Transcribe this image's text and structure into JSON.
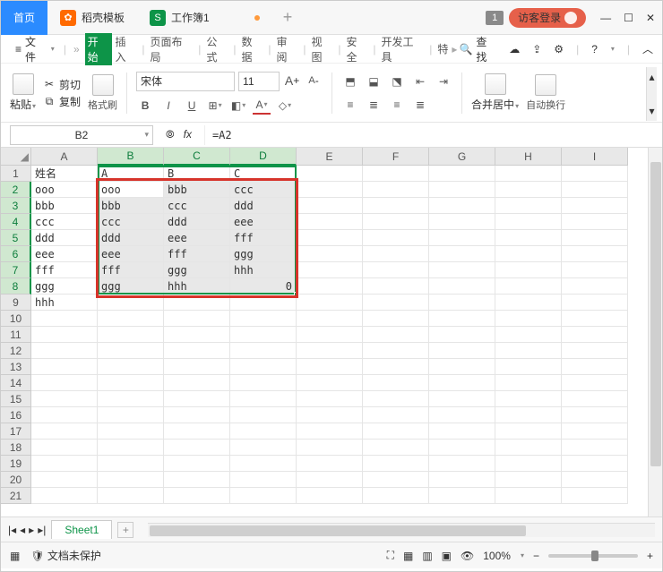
{
  "titlebar": {
    "home": "首页",
    "shell": "稻壳模板",
    "doc": "工作簿1",
    "badge": "1",
    "login": "访客登录"
  },
  "menu": {
    "file": "文件",
    "items": [
      "开始",
      "插入",
      "页面布局",
      "公式",
      "数据",
      "审阅",
      "视图",
      "安全",
      "开发工具",
      "特"
    ],
    "search": "查找"
  },
  "ribbon": {
    "paste": "粘贴",
    "cut": "剪切",
    "copy": "复制",
    "painter": "格式刷",
    "font": "宋体",
    "size": "11",
    "merge": "合并居中",
    "wrap": "自动换行"
  },
  "fx": {
    "nameref": "B2",
    "formula": "=A2"
  },
  "columns": [
    "A",
    "B",
    "C",
    "D",
    "E",
    "F",
    "G",
    "H",
    "I"
  ],
  "rows": [
    "1",
    "2",
    "3",
    "4",
    "5",
    "6",
    "7",
    "8",
    "9",
    "10",
    "11",
    "12",
    "13",
    "14",
    "15",
    "16",
    "17",
    "18",
    "19",
    "20",
    "21"
  ],
  "data": {
    "r1": {
      "A": "姓名",
      "B": "A",
      "C": "B",
      "D": "C"
    },
    "r2": {
      "A": "ooo",
      "B": "ooo",
      "C": "bbb",
      "D": "ccc"
    },
    "r3": {
      "A": "bbb",
      "B": "bbb",
      "C": "ccc",
      "D": "ddd"
    },
    "r4": {
      "A": "ccc",
      "B": "ccc",
      "C": "ddd",
      "D": "eee"
    },
    "r5": {
      "A": "ddd",
      "B": "ddd",
      "C": "eee",
      "D": "fff"
    },
    "r6": {
      "A": "eee",
      "B": "eee",
      "C": "fff",
      "D": "ggg"
    },
    "r7": {
      "A": "fff",
      "B": "fff",
      "C": "ggg",
      "D": "hhh"
    },
    "r8": {
      "A": "ggg",
      "B": "ggg",
      "C": "hhh",
      "D": "0"
    },
    "r9": {
      "A": "hhh"
    }
  },
  "sheet": {
    "name": "Sheet1"
  },
  "status": {
    "protect": "文档未保护",
    "zoom": "100%"
  }
}
